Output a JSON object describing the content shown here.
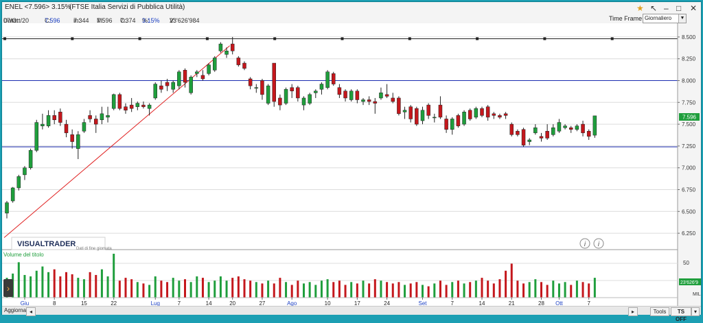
{
  "window": {
    "title_symbol": "ENEL <7.596> 3.15%",
    "title_index": "(FTSE Italia Servizi di Pubblica Utilità)"
  },
  "info": {
    "data_label": "Data:",
    "data_value": "07/Ott/20",
    "c_label": "C:",
    "c_value": "7.596",
    "m_label": "m:",
    "m_value": "7.344",
    "M_label": "M:",
    "M_value": "7.596",
    "o_label": "O:",
    "o_value": "7.374",
    "pct_label": "%:",
    "pct_value": "3.15%",
    "v_label": "V:",
    "v_value": "23'626'984"
  },
  "timeframe": {
    "label": "Time Frame",
    "selected": "Giornaliero"
  },
  "watermark": {
    "brand": "VISUALTRADER",
    "note": "Dati di fine giornata"
  },
  "volume_panel": {
    "title": "Volume del titolo",
    "axis_label": "50",
    "last_value": "23'626'9",
    "unit": "MIL"
  },
  "price_label": "7.596",
  "bottom": {
    "update_label": "Aggiorna",
    "tools_label": "Tools",
    "ts_label": "TS OFF"
  },
  "colors": {
    "up": "#1f9e3c",
    "down": "#c4171c",
    "accent_blue": "#1a3fc4",
    "trendline": "#e02020"
  },
  "chart_data": {
    "type": "candlestick",
    "ylim": [
      6.125,
      8.625
    ],
    "yticks": [
      "8.500",
      "8.250",
      "8.000",
      "7.750",
      "7.500",
      "7.250",
      "7.000",
      "6.750",
      "6.500",
      "6.250"
    ],
    "ytick_values": [
      8.5,
      8.25,
      8.0,
      7.75,
      7.5,
      7.25,
      7.0,
      6.75,
      6.5,
      6.25
    ],
    "xticks": [
      {
        "label": "Giu",
        "index": 3,
        "month": true
      },
      {
        "label": "8",
        "index": 8,
        "month": false
      },
      {
        "label": "15",
        "index": 13,
        "month": false
      },
      {
        "label": "22",
        "index": 18,
        "month": false
      },
      {
        "label": "Lug",
        "index": 25,
        "month": true
      },
      {
        "label": "7",
        "index": 29,
        "month": false
      },
      {
        "label": "14",
        "index": 34,
        "month": false
      },
      {
        "label": "20",
        "index": 38,
        "month": false
      },
      {
        "label": "27",
        "index": 43,
        "month": false
      },
      {
        "label": "Ago",
        "index": 48,
        "month": true
      },
      {
        "label": "10",
        "index": 54,
        "month": false
      },
      {
        "label": "17",
        "index": 59,
        "month": false
      },
      {
        "label": "24",
        "index": 64,
        "month": false
      },
      {
        "label": "Set",
        "index": 70,
        "month": true
      },
      {
        "label": "7",
        "index": 75,
        "month": false
      },
      {
        "label": "14",
        "index": 80,
        "month": false
      },
      {
        "label": "21",
        "index": 85,
        "month": false
      },
      {
        "label": "28",
        "index": 90,
        "month": false
      },
      {
        "label": "Ott",
        "index": 93,
        "month": true
      },
      {
        "label": "7",
        "index": 98,
        "month": false
      }
    ],
    "hlines": [
      8.48,
      8.0,
      7.24
    ],
    "trendline": [
      {
        "index": 0,
        "price": 6.2
      },
      {
        "index": 38,
        "price": 8.4
      }
    ],
    "candles": [
      {
        "o": 6.48,
        "h": 6.62,
        "l": 6.42,
        "c": 6.6
      },
      {
        "o": 6.62,
        "h": 6.78,
        "l": 6.6,
        "c": 6.77
      },
      {
        "o": 6.77,
        "h": 6.92,
        "l": 6.74,
        "c": 6.9
      },
      {
        "o": 6.92,
        "h": 7.02,
        "l": 6.86,
        "c": 7.0
      },
      {
        "o": 7.0,
        "h": 7.22,
        "l": 6.98,
        "c": 7.2
      },
      {
        "o": 7.2,
        "h": 7.55,
        "l": 7.18,
        "c": 7.52
      },
      {
        "o": 7.48,
        "h": 7.62,
        "l": 7.44,
        "c": 7.5
      },
      {
        "o": 7.48,
        "h": 7.66,
        "l": 7.46,
        "c": 7.6
      },
      {
        "o": 7.6,
        "h": 7.66,
        "l": 7.5,
        "c": 7.55
      },
      {
        "o": 7.64,
        "h": 7.68,
        "l": 7.48,
        "c": 7.52
      },
      {
        "o": 7.5,
        "h": 7.55,
        "l": 7.35,
        "c": 7.4
      },
      {
        "o": 7.38,
        "h": 7.44,
        "l": 7.22,
        "c": 7.3
      },
      {
        "o": 7.22,
        "h": 7.42,
        "l": 7.1,
        "c": 7.38
      },
      {
        "o": 7.42,
        "h": 7.56,
        "l": 7.4,
        "c": 7.52
      },
      {
        "o": 7.6,
        "h": 7.66,
        "l": 7.52,
        "c": 7.56
      },
      {
        "o": 7.56,
        "h": 7.6,
        "l": 7.4,
        "c": 7.5
      },
      {
        "o": 7.55,
        "h": 7.7,
        "l": 7.5,
        "c": 7.62
      },
      {
        "o": 7.58,
        "h": 7.7,
        "l": 7.52,
        "c": 7.6
      },
      {
        "o": 7.68,
        "h": 7.85,
        "l": 7.66,
        "c": 7.84
      },
      {
        "o": 7.84,
        "h": 7.86,
        "l": 7.66,
        "c": 7.68
      },
      {
        "o": 7.7,
        "h": 7.74,
        "l": 7.62,
        "c": 7.66
      },
      {
        "o": 7.72,
        "h": 7.8,
        "l": 7.64,
        "c": 7.68
      },
      {
        "o": 7.7,
        "h": 7.76,
        "l": 7.66,
        "c": 7.74
      },
      {
        "o": 7.72,
        "h": 7.76,
        "l": 7.68,
        "c": 7.7
      },
      {
        "o": 7.68,
        "h": 7.74,
        "l": 7.6,
        "c": 7.72
      },
      {
        "o": 7.8,
        "h": 7.98,
        "l": 7.78,
        "c": 7.96
      },
      {
        "o": 7.94,
        "h": 8.0,
        "l": 7.86,
        "c": 7.9
      },
      {
        "o": 7.98,
        "h": 8.02,
        "l": 7.88,
        "c": 7.94
      },
      {
        "o": 7.9,
        "h": 8.0,
        "l": 7.86,
        "c": 7.98
      },
      {
        "o": 7.94,
        "h": 8.12,
        "l": 7.9,
        "c": 8.1
      },
      {
        "o": 8.12,
        "h": 8.14,
        "l": 7.92,
        "c": 7.98
      },
      {
        "o": 7.86,
        "h": 8.06,
        "l": 7.84,
        "c": 8.04
      },
      {
        "o": 8.08,
        "h": 8.12,
        "l": 8.04,
        "c": 8.1
      },
      {
        "o": 8.06,
        "h": 8.12,
        "l": 8.0,
        "c": 8.02
      },
      {
        "o": 8.08,
        "h": 8.2,
        "l": 8.06,
        "c": 8.18
      },
      {
        "o": 8.12,
        "h": 8.28,
        "l": 8.1,
        "c": 8.26
      },
      {
        "o": 8.34,
        "h": 8.44,
        "l": 8.32,
        "c": 8.42
      },
      {
        "o": 8.3,
        "h": 8.38,
        "l": 8.26,
        "c": 8.34
      },
      {
        "o": 8.42,
        "h": 8.5,
        "l": 8.3,
        "c": 8.34
      },
      {
        "o": 8.26,
        "h": 8.28,
        "l": 8.16,
        "c": 8.18
      },
      {
        "o": 8.2,
        "h": 8.22,
        "l": 8.12,
        "c": 8.14
      },
      {
        "o": 8.02,
        "h": 8.04,
        "l": 7.9,
        "c": 7.94
      },
      {
        "o": 7.92,
        "h": 7.96,
        "l": 7.86,
        "c": 7.92
      },
      {
        "o": 8.0,
        "h": 8.02,
        "l": 7.78,
        "c": 7.84
      },
      {
        "o": 7.74,
        "h": 7.96,
        "l": 7.72,
        "c": 7.94
      },
      {
        "o": 8.2,
        "h": 8.2,
        "l": 7.7,
        "c": 7.76
      },
      {
        "o": 7.8,
        "h": 7.84,
        "l": 7.66,
        "c": 7.72
      },
      {
        "o": 7.74,
        "h": 7.92,
        "l": 7.72,
        "c": 7.9
      },
      {
        "o": 7.92,
        "h": 7.96,
        "l": 7.8,
        "c": 7.88
      },
      {
        "o": 7.92,
        "h": 7.94,
        "l": 7.76,
        "c": 7.8
      },
      {
        "o": 7.72,
        "h": 7.82,
        "l": 7.66,
        "c": 7.8
      },
      {
        "o": 7.74,
        "h": 7.86,
        "l": 7.72,
        "c": 7.84
      },
      {
        "o": 7.86,
        "h": 7.9,
        "l": 7.8,
        "c": 7.88
      },
      {
        "o": 7.9,
        "h": 7.98,
        "l": 7.84,
        "c": 7.96
      },
      {
        "o": 7.92,
        "h": 8.12,
        "l": 7.9,
        "c": 8.1
      },
      {
        "o": 8.08,
        "h": 8.1,
        "l": 7.94,
        "c": 7.96
      },
      {
        "o": 7.92,
        "h": 7.96,
        "l": 7.8,
        "c": 7.84
      },
      {
        "o": 7.88,
        "h": 7.9,
        "l": 7.76,
        "c": 7.8
      },
      {
        "o": 7.78,
        "h": 7.9,
        "l": 7.76,
        "c": 7.88
      },
      {
        "o": 7.88,
        "h": 7.9,
        "l": 7.74,
        "c": 7.78
      },
      {
        "o": 7.76,
        "h": 7.8,
        "l": 7.72,
        "c": 7.78
      },
      {
        "o": 7.78,
        "h": 7.82,
        "l": 7.72,
        "c": 7.76
      },
      {
        "o": 7.76,
        "h": 7.8,
        "l": 7.62,
        "c": 7.74
      },
      {
        "o": 7.8,
        "h": 7.92,
        "l": 7.78,
        "c": 7.86
      },
      {
        "o": 7.84,
        "h": 7.96,
        "l": 7.8,
        "c": 7.82
      },
      {
        "o": 7.8,
        "h": 7.86,
        "l": 7.74,
        "c": 7.76
      },
      {
        "o": 7.8,
        "h": 7.82,
        "l": 7.6,
        "c": 7.62
      },
      {
        "o": 7.64,
        "h": 7.7,
        "l": 7.56,
        "c": 7.66
      },
      {
        "o": 7.7,
        "h": 7.72,
        "l": 7.52,
        "c": 7.56
      },
      {
        "o": 7.68,
        "h": 7.7,
        "l": 7.48,
        "c": 7.5
      },
      {
        "o": 7.54,
        "h": 7.7,
        "l": 7.5,
        "c": 7.66
      },
      {
        "o": 7.72,
        "h": 7.74,
        "l": 7.56,
        "c": 7.6
      },
      {
        "o": 7.58,
        "h": 7.62,
        "l": 7.52,
        "c": 7.58
      },
      {
        "o": 7.72,
        "h": 7.82,
        "l": 7.56,
        "c": 7.58
      },
      {
        "o": 7.56,
        "h": 7.6,
        "l": 7.4,
        "c": 7.44
      },
      {
        "o": 7.44,
        "h": 7.58,
        "l": 7.38,
        "c": 7.56
      },
      {
        "o": 7.6,
        "h": 7.62,
        "l": 7.46,
        "c": 7.48
      },
      {
        "o": 7.5,
        "h": 7.66,
        "l": 7.48,
        "c": 7.64
      },
      {
        "o": 7.66,
        "h": 7.68,
        "l": 7.54,
        "c": 7.56
      },
      {
        "o": 7.58,
        "h": 7.7,
        "l": 7.56,
        "c": 7.68
      },
      {
        "o": 7.68,
        "h": 7.7,
        "l": 7.58,
        "c": 7.6
      },
      {
        "o": 7.7,
        "h": 7.72,
        "l": 7.54,
        "c": 7.58
      },
      {
        "o": 7.62,
        "h": 7.64,
        "l": 7.56,
        "c": 7.6
      },
      {
        "o": 7.6,
        "h": 7.62,
        "l": 7.56,
        "c": 7.58
      },
      {
        "o": 7.62,
        "h": 7.64,
        "l": 7.56,
        "c": 7.6
      },
      {
        "o": 7.5,
        "h": 7.52,
        "l": 7.36,
        "c": 7.38
      },
      {
        "o": 7.42,
        "h": 7.44,
        "l": 7.36,
        "c": 7.38
      },
      {
        "o": 7.44,
        "h": 7.46,
        "l": 7.24,
        "c": 7.26
      },
      {
        "o": 7.3,
        "h": 7.34,
        "l": 7.26,
        "c": 7.32
      },
      {
        "o": 7.4,
        "h": 7.5,
        "l": 7.38,
        "c": 7.46
      },
      {
        "o": 7.36,
        "h": 7.4,
        "l": 7.3,
        "c": 7.34
      },
      {
        "o": 7.42,
        "h": 7.5,
        "l": 7.32,
        "c": 7.34
      },
      {
        "o": 7.38,
        "h": 7.5,
        "l": 7.36,
        "c": 7.46
      },
      {
        "o": 7.42,
        "h": 7.56,
        "l": 7.4,
        "c": 7.52
      },
      {
        "o": 7.46,
        "h": 7.5,
        "l": 7.44,
        "c": 7.48
      },
      {
        "o": 7.46,
        "h": 7.48,
        "l": 7.4,
        "c": 7.44
      },
      {
        "o": 7.44,
        "h": 7.5,
        "l": 7.42,
        "c": 7.48
      },
      {
        "o": 7.5,
        "h": 7.54,
        "l": 7.36,
        "c": 7.4
      },
      {
        "o": 7.42,
        "h": 7.44,
        "l": 7.32,
        "c": 7.36
      },
      {
        "o": 7.374,
        "h": 7.596,
        "l": 7.344,
        "c": 7.596
      }
    ],
    "volume": [
      28,
      34,
      50,
      32,
      30,
      38,
      44,
      36,
      40,
      30,
      36,
      33,
      28,
      26,
      36,
      32,
      40,
      30,
      62,
      24,
      28,
      26,
      22,
      20,
      18,
      30,
      24,
      22,
      28,
      24,
      26,
      22,
      30,
      28,
      22,
      24,
      30,
      24,
      28,
      30,
      26,
      24,
      22,
      20,
      24,
      20,
      28,
      22,
      18,
      24,
      20,
      22,
      18,
      24,
      26,
      22,
      24,
      18,
      22,
      20,
      24,
      20,
      26,
      24,
      22,
      20,
      22,
      18,
      20,
      22,
      18,
      16,
      20,
      24,
      18,
      22,
      24,
      20,
      22,
      24,
      28,
      24,
      20,
      26,
      38,
      48,
      24,
      20,
      22,
      26,
      22,
      18,
      24,
      20,
      22,
      18,
      24,
      22,
      20,
      28
    ]
  }
}
